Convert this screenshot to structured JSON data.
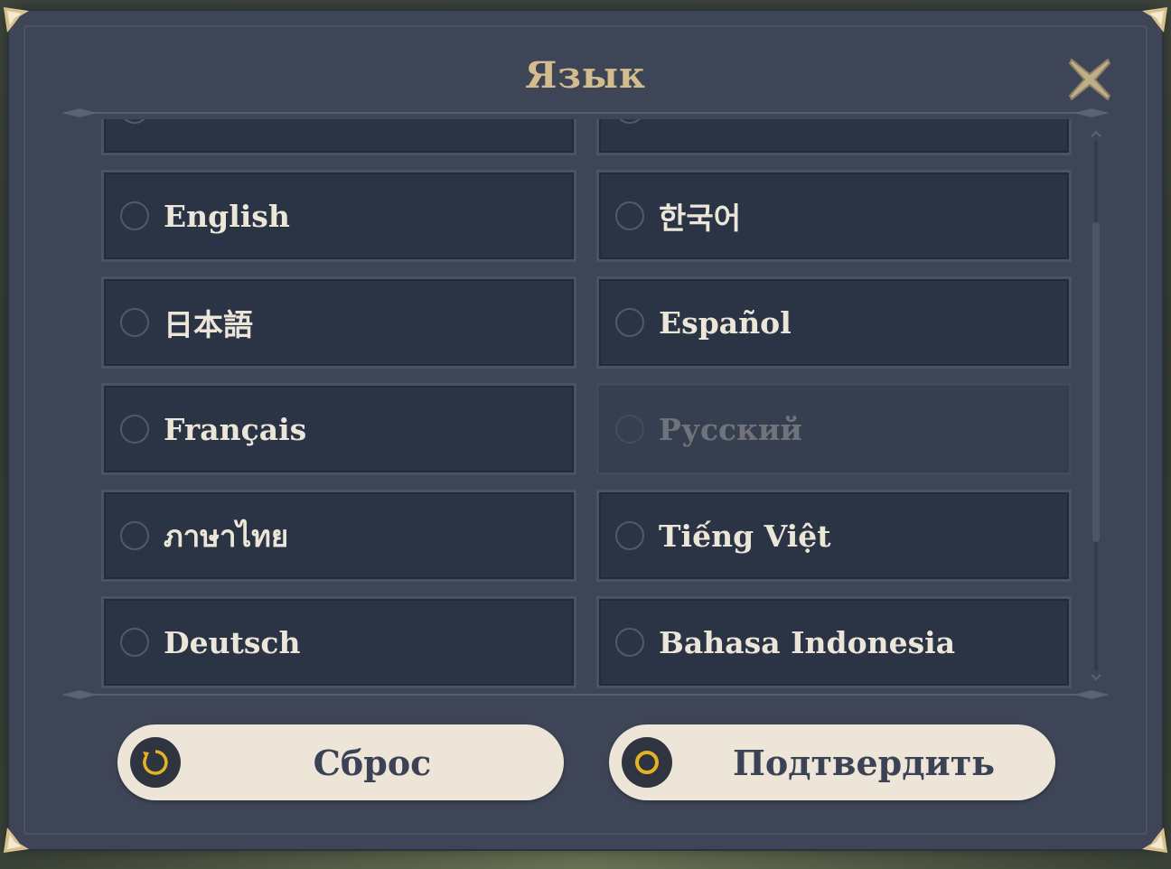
{
  "dialog": {
    "title": "Язык"
  },
  "languages": [
    {
      "label": "",
      "state": "normal"
    },
    {
      "label": "",
      "state": "normal"
    },
    {
      "label": "English",
      "state": "normal"
    },
    {
      "label": "한국어",
      "state": "normal"
    },
    {
      "label": "日本語",
      "state": "normal"
    },
    {
      "label": "Español",
      "state": "normal"
    },
    {
      "label": "Français",
      "state": "normal"
    },
    {
      "label": "Русский",
      "state": "disabled"
    },
    {
      "label": "ภาษาไทย",
      "state": "normal"
    },
    {
      "label": "Tiếng Việt",
      "state": "normal"
    },
    {
      "label": "Deutsch",
      "state": "normal"
    },
    {
      "label": "Bahasa Indonesia",
      "state": "normal"
    }
  ],
  "buttons": {
    "reset_label": "Сброс",
    "confirm_label": "Подтвердить"
  },
  "icons": {
    "close": "close-icon",
    "reset": "refresh-icon",
    "confirm": "circle-icon",
    "radio": "radio-icon"
  },
  "colors": {
    "panel": "#3e4557",
    "title": "#d3bc8e",
    "option_bg": "#2a3444",
    "button_bg": "#ece5d8",
    "accent_gold": "#e6b422"
  }
}
